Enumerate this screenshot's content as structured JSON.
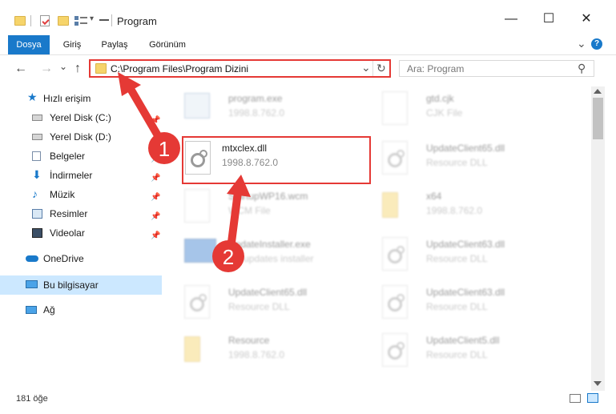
{
  "window": {
    "title": "Program",
    "minimize_glyph": "—",
    "maximize_glyph": "☐",
    "close_glyph": "✕",
    "qat_dropdown": "▾"
  },
  "ribbon": {
    "tabs": [
      "Dosya",
      "Giriş",
      "Paylaş",
      "Görünüm"
    ],
    "expand_glyph": "⌄",
    "help_glyph": "?"
  },
  "address": {
    "path": "C:\\Program Files\\Program Dizini",
    "dropdown_glyph": "⌄",
    "refresh_glyph": "↻"
  },
  "nav_buttons": {
    "back": "←",
    "forward": "→",
    "recent": "⌄",
    "up": "↑"
  },
  "search": {
    "placeholder": "Ara: Program",
    "icon_glyph": "⚲"
  },
  "sidebar": {
    "items": [
      {
        "label": "Hızlı erişim",
        "icon": "star-icon"
      },
      {
        "label": "Yerel Disk (C:)",
        "icon": "drive-icon",
        "pinned": true
      },
      {
        "label": "Yerel Disk (D:)",
        "icon": "drive-icon",
        "pinned": true
      },
      {
        "label": "Belgeler",
        "icon": "documents-icon",
        "pinned": true
      },
      {
        "label": "İndirmeler",
        "icon": "download-icon",
        "pinned": true
      },
      {
        "label": "Müzik",
        "icon": "music-icon",
        "pinned": true
      },
      {
        "label": "Resimler",
        "icon": "pictures-icon",
        "pinned": true
      },
      {
        "label": "Videolar",
        "icon": "videos-icon",
        "pinned": true
      },
      {
        "label": "OneDrive",
        "icon": "cloud-icon"
      },
      {
        "label": "Bu bilgisayar",
        "icon": "computer-icon",
        "selected": true
      },
      {
        "label": "Ağ",
        "icon": "network-icon"
      }
    ],
    "pin_glyph": "📌"
  },
  "files": [
    {
      "name": "program.exe",
      "desc": "1998.8.762.0",
      "icon": "exe-icon"
    },
    {
      "name": "gtd.cjk",
      "desc": "CJK File",
      "icon": "file-icon"
    },
    {
      "name": "mtxclex.dll",
      "desc": "1998.8.762.0",
      "icon": "dll-icon"
    },
    {
      "name": "UpdateClient65.dll",
      "desc": "Resource DLL",
      "icon": "dll-icon"
    },
    {
      "name": "StartupWP16.wcm",
      "desc": "WCM File",
      "icon": "file-icon"
    },
    {
      "name": "x64",
      "desc": "1998.8.762.0",
      "icon": "folder-icon"
    },
    {
      "name": "UpdateInstaller.exe",
      "desc": "XY updates installer",
      "icon": "installer-icon"
    },
    {
      "name": "UpdateClient63.dll",
      "desc": "Resource DLL",
      "icon": "dll-icon"
    },
    {
      "name": "UpdateClient65.dll",
      "desc": "Resource DLL",
      "icon": "dll-icon"
    },
    {
      "name": "UpdateClient63.dll",
      "desc": "Resource DLL",
      "icon": "dll-icon"
    },
    {
      "name": "Resource",
      "desc": "1998.8.762.0",
      "icon": "folder-icon"
    },
    {
      "name": "UpdateClient5.dll",
      "desc": "Resource DLL",
      "icon": "dll-icon"
    }
  ],
  "status": {
    "count": "181 öğe"
  },
  "annotations": {
    "step1": "1",
    "step2": "2",
    "color": "#e53935"
  },
  "colors": {
    "accent": "#1979ca",
    "highlight": "#e53935",
    "selected_bg": "#cce8ff"
  }
}
